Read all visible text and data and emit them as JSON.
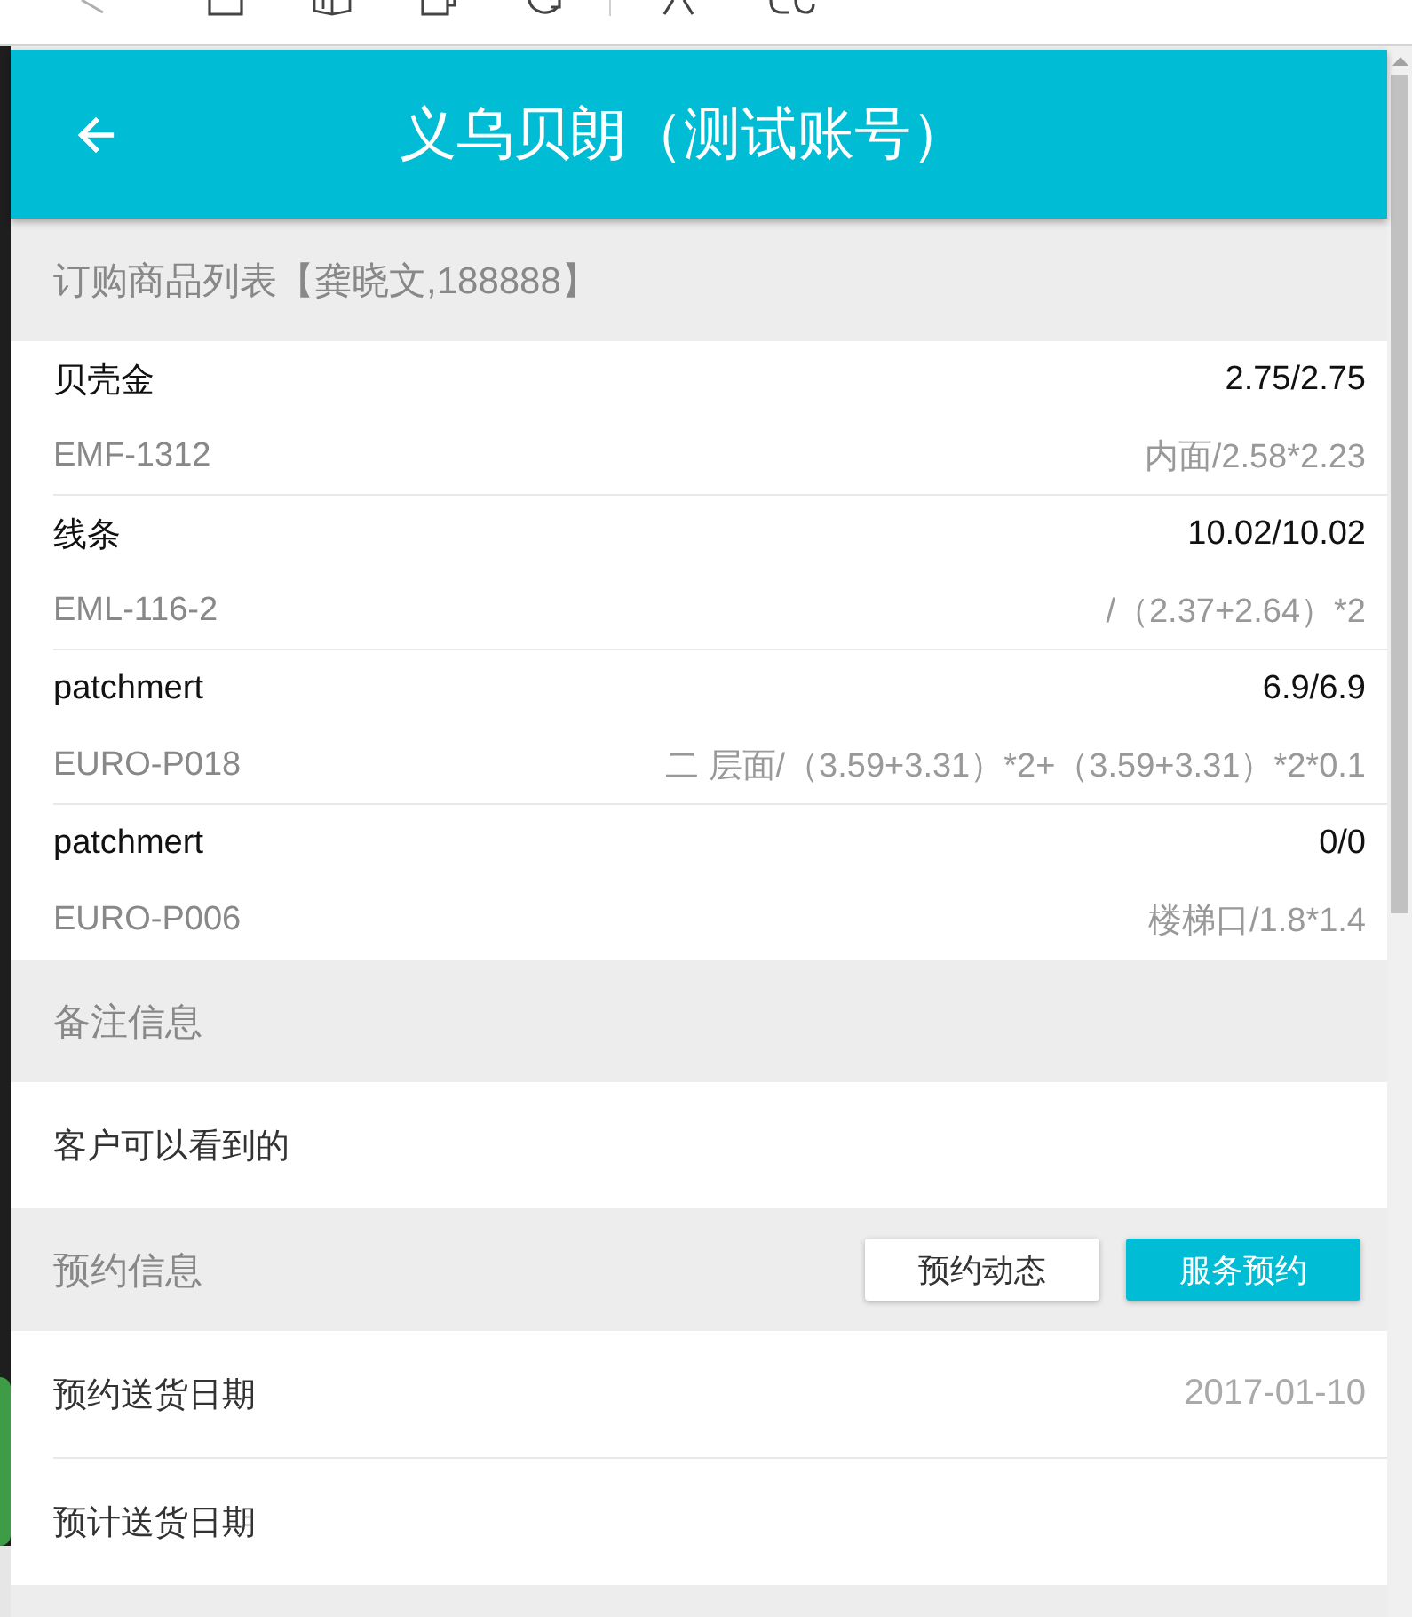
{
  "header": {
    "title": "义乌贝朗（测试账号）"
  },
  "sections": [
    {
      "kind": "products",
      "title": "订购商品列表【龚晓文,188888】",
      "items": [
        {
          "name": "贝壳金",
          "quantity": "2.75/2.75",
          "code": "EMF-1312",
          "spec": "内面/2.58*2.23"
        },
        {
          "name": "线条",
          "quantity": "10.02/10.02",
          "code": "EML-116-2",
          "spec": "/（2.37+2.64）*2"
        },
        {
          "name": "patchmert",
          "quantity": "6.9/6.9",
          "code": "EURO-P018",
          "spec": "二 层面/（3.59+3.31）*2+（3.59+3.31）*2*0.1"
        },
        {
          "name": "patchmert",
          "quantity": "0/0",
          "code": "EURO-P006",
          "spec": "楼梯口/1.8*1.4"
        }
      ]
    },
    {
      "kind": "note",
      "title": "备注信息",
      "text": "客户可以看到的"
    },
    {
      "kind": "appointment",
      "title": "预约信息",
      "buttons": [
        {
          "label": "预约动态",
          "primary": false
        },
        {
          "label": "服务预约",
          "primary": true
        }
      ],
      "fields": [
        {
          "label": "预约送货日期",
          "value": "2017-01-10"
        },
        {
          "label": "预计送货日期"
        }
      ]
    }
  ]
}
